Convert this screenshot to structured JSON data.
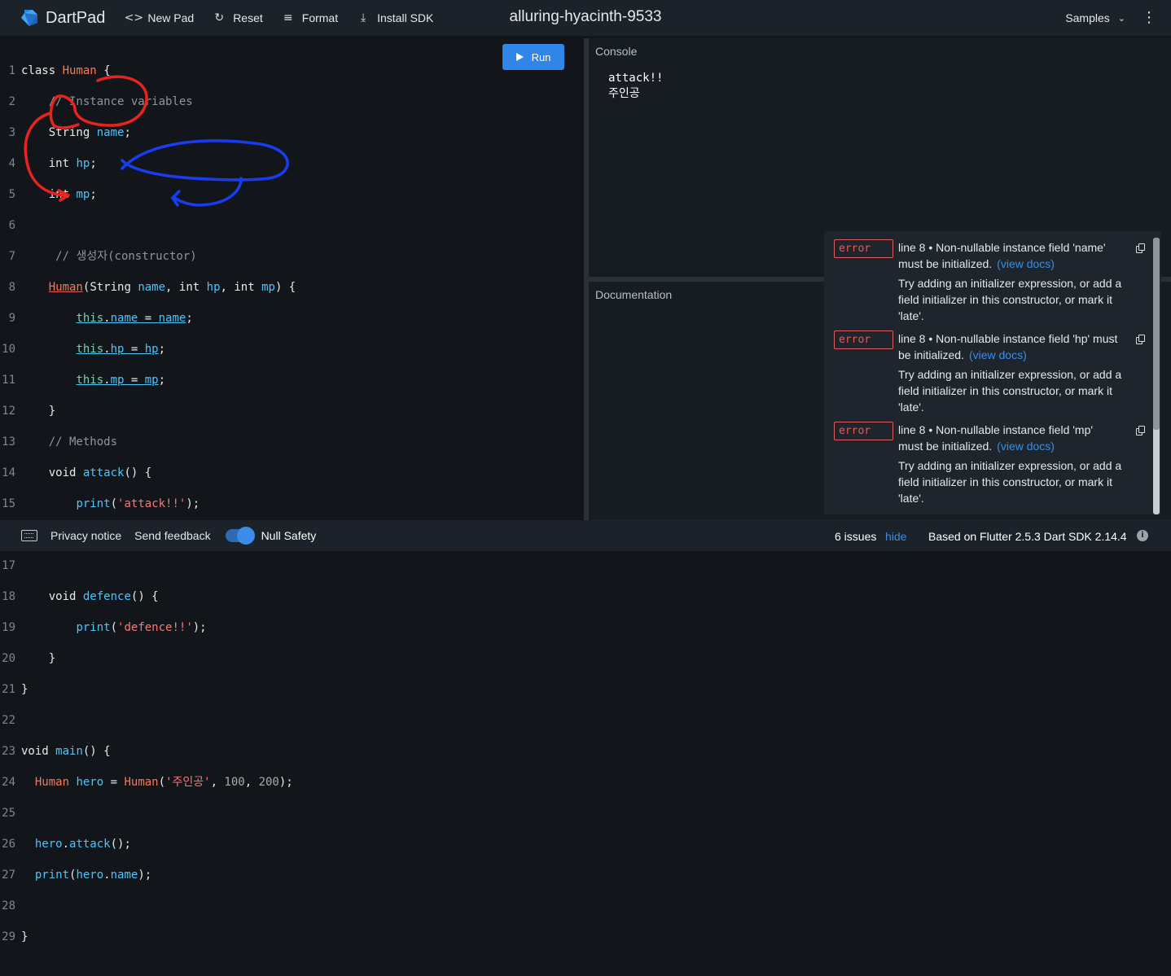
{
  "header": {
    "brand": "DartPad",
    "new_pad": "New Pad",
    "reset": "Reset",
    "format": "Format",
    "install_sdk": "Install SDK",
    "pad_title": "alluring-hyacinth-9533",
    "samples": "Samples"
  },
  "editor": {
    "run_label": "Run",
    "code_lines": [
      "class Human {",
      "    // Instance variables",
      "    String name;",
      "    int hp;",
      "    int mp;",
      "",
      "     // 생성자(constructor)",
      "    Human(String name, int hp, int mp) {",
      "        this.name = name;",
      "        this.hp = hp;",
      "        this.mp = mp;",
      "    }",
      "    // Methods",
      "    void attack() {",
      "        print('attack!!');",
      "    }",
      "",
      "    void defence() {",
      "        print('defence!!');",
      "    }",
      "}",
      "",
      "void main() {",
      "  Human hero = Human('주인공', 100, 200);",
      "",
      "  hero.attack();",
      "  print(hero.name);",
      "",
      "}"
    ]
  },
  "console": {
    "label": "Console",
    "output": [
      "attack!!",
      "주인공"
    ]
  },
  "documentation": {
    "label": "Documentation"
  },
  "issues_panel": {
    "items": [
      {
        "severity": "error",
        "message": "line 8 • Non-nullable instance field 'name' must be initialized.",
        "link": "(view docs)",
        "tip": "Try adding an initializer expression, or add a field initializer in this constructor, or mark it 'late'."
      },
      {
        "severity": "error",
        "message": "line 8 • Non-nullable instance field 'hp' must be initialized.",
        "link": "(view docs)",
        "tip": "Try adding an initializer expression, or add a field initializer in this constructor, or mark it 'late'."
      },
      {
        "severity": "error",
        "message": "line 8 • Non-nullable instance field 'mp' must be initialized.",
        "link": "(view docs)",
        "tip": "Try adding an initializer expression, or add a field initializer in this constructor, or mark it 'late'."
      }
    ]
  },
  "footer": {
    "privacy": "Privacy notice",
    "feedback": "Send feedback",
    "null_safety": "Null Safety",
    "null_safety_on": true,
    "issue_count": "6 issues",
    "hide": "hide",
    "based_on": "Based on Flutter 2.5.3 Dart SDK 2.14.4"
  },
  "colors": {
    "accent": "#2f86e8",
    "error": "#e25c5c",
    "annotation_red": "#e8231e",
    "annotation_blue": "#1a3cf0"
  },
  "icons": [
    "dart-logo-icon",
    "code-icon",
    "refresh-icon",
    "format-align-icon",
    "download-icon",
    "chevron-down-icon",
    "more-vert-icon",
    "play-icon",
    "copy-icon",
    "keyboard-icon",
    "info-icon"
  ]
}
